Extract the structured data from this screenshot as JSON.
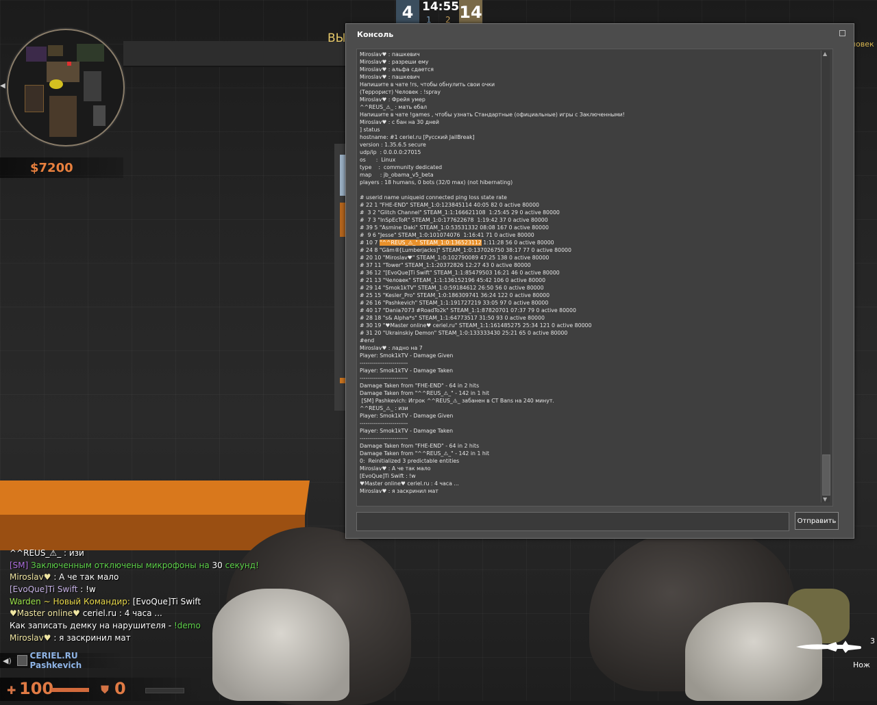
{
  "score": {
    "ct": "4",
    "t": "14",
    "time": "14:55",
    "ct_alive": "1",
    "t_alive": "2"
  },
  "background_text": {
    "left": "ВЫ",
    "right": "ловек"
  },
  "money": "$7200",
  "console": {
    "title": "Консоль",
    "send_label": "Отправить",
    "input_value": "",
    "lines": [
      "Miroslav♥ : пашкевич",
      "Miroslav♥ : разреши ему",
      "Miroslav♥ : альфа сдается",
      "Miroslav♥ : пашкевич",
      "Напишите в чате !rs, чтобы обнулить свои очки",
      "(Террорист) Человек : !spray",
      "Miroslav♥ : Фрейя умер",
      "^^REUS_⚠_ : мать ебал",
      "Напишите в чате !games , чтобы узнать Стандартные (официальные) игры с Заключенными!",
      "Miroslav♥ : с бан на 30 дней",
      "] status",
      "hostname: #1 ceriel.ru [Русский JailBreak]",
      "version : 1.35.6.5 secure",
      "udp/ip  : 0.0.0.0:27015",
      "os      :  Linux",
      "type    :  community dedicated",
      "map     : jb_obama_v5_beta",
      "players : 18 humans, 0 bots (32/0 max) (not hibernating)",
      "",
      "# userid name uniqueid connected ping loss state rate",
      "# 22 1 \"FHE-END\" STEAM_1:0:123845114 40:05 82 0 active 80000",
      "#  3 2 \"Glitch Channel\" STEAM_1:1:166621108  1:25:45 29 0 active 80000",
      "#  7 3 \"InSpEcToR\" STEAM_1:0:177622678  1:19:42 37 0 active 80000",
      "# 39 5 \"Asmine Daki\" STEAM_1:0:53531332 08:08 167 0 active 80000",
      "#  9 6 \"Jesse\" STEAM_1:0:101074076  1:16:41 71 0 active 80000",
      "# 10 7 ",
      "# 24 8 \"Gäm®[Lumberjacks]\" STEAM_1:0:137026750 38:17 77 0 active 80000",
      "# 20 10 \"Miroslav♥\" STEAM_1:0:102790089 47:25 138 0 active 80000",
      "# 37 11 \"Tower\" STEAM_1:1:20372826 12:27 43 0 active 80000",
      "# 36 12 \"[EvoQue]Ti Swift\" STEAM_1:1:85479503 16:21 46 0 active 80000",
      "# 21 13 \"Человек\" STEAM_1:1:136152196 45:42 106 0 active 80000",
      "# 29 14 \"Smok1kTV\" STEAM_1:0:59184612 26:50 56 0 active 80000",
      "# 25 15 \"Kesler_Pro\" STEAM_1:0:186309741 36:24 122 0 active 80000",
      "# 26 16 \"Pashkevich\" STEAM_1:1:191727219 33:05 97 0 active 80000",
      "# 40 17 \"Dania7073 #RoadTo2k\" STEAM_1:1:87820701 07:37 79 0 active 80000",
      "# 28 18 \"s& Alpha*s\" STEAM_1:1:64773517 31:50 93 0 active 80000",
      "# 30 19 \"♥Master online♥ ceriel.ru\" STEAM_1:1:161485275 25:34 121 0 active 80000",
      "# 31 20 \"Ukrainskiy Demon\" STEAM_1:0:133333430 25:21 65 0 active 80000",
      "#end",
      "Miroslav♥ : ладно на 7",
      "Player: Smok1kTV - Damage Given",
      "-------------------------",
      "Player: Smok1kTV - Damage Taken",
      "-------------------------",
      "Damage Taken from \"FHE-END\" - 64 in 2 hits",
      "Damage Taken from \"^^REUS_⚠_\" - 142 in 1 hit",
      " [SM] Pashkevich: Игрок ^^REUS_⚠_ забанен в CT Bans на 240 минут.",
      "^^REUS_⚠_ : изи",
      "Player: Smok1kTV - Damage Given",
      "-------------------------",
      "Player: Smok1kTV - Damage Taken",
      "-------------------------",
      "Damage Taken from \"FHE-END\" - 64 in 2 hits",
      "Damage Taken from \"^^REUS_⚠_\" - 142 in 1 hit",
      "0:  Reinitialized 3 predictable entities",
      "Miroslav♥ : А че так мало",
      "[EvoQue]Ti Swift : !w",
      "♥Master online♥ ceriel.ru : 4 часа ...",
      "Miroslav♥ : я заскринил мат"
    ],
    "highlight_line_index": 25,
    "highlight_text": "\"^^REUS_⚠_\" STEAM_1:0:136523112",
    "highlight_tail": " 1:11:28 56 0 active 80000"
  },
  "chat": [
    [
      {
        "t": "^^REUS_⚠_",
        "c": "c-white"
      },
      {
        "t": " : изи",
        "c": "c-white"
      }
    ],
    [
      {
        "t": " [SM] ",
        "c": "c-purple"
      },
      {
        "t": "Заключенным отключены микрофоны на ",
        "c": "c-green"
      },
      {
        "t": "30",
        "c": "c-white"
      },
      {
        "t": " секунд!",
        "c": "c-green"
      }
    ],
    [
      {
        "t": "Miroslav♥",
        "c": "c-cream"
      },
      {
        "t": " : А че так мало",
        "c": "c-white"
      }
    ],
    [
      {
        "t": "[EvoQue]Ti Swift",
        "c": "c-lavender"
      },
      {
        "t": " : !w",
        "c": "c-white"
      }
    ],
    [
      {
        "t": " Warden",
        "c": "c-lime"
      },
      {
        "t": " ~ Новый Командир: ",
        "c": "c-yellow"
      },
      {
        "t": "[EvoQue]Ti Swift",
        "c": "c-white"
      }
    ],
    [
      {
        "t": "♥Master online♥",
        "c": "c-cream"
      },
      {
        "t": " ceriel.ru : 4 часа ...",
        "c": "c-white"
      }
    ],
    [
      {
        "t": "Как записать демку на нарушителя - ",
        "c": "c-white"
      },
      {
        "t": "!demo",
        "c": "c-green"
      }
    ],
    [
      {
        "t": "Miroslav♥",
        "c": "c-cream"
      },
      {
        "t": " : я заскринил мат",
        "c": "c-white"
      }
    ]
  ],
  "voice": {
    "name": "CERIEL.RU Pashkevich"
  },
  "health": {
    "value": "100",
    "fraction": 1.0
  },
  "armor": {
    "value": "0",
    "fraction": 0.0
  },
  "weapon": {
    "name": "Нож",
    "slot": "3"
  },
  "colors": {
    "accent": "#e07a44",
    "console_bg": "#4c4c4c",
    "highlight": "#e8902a"
  }
}
